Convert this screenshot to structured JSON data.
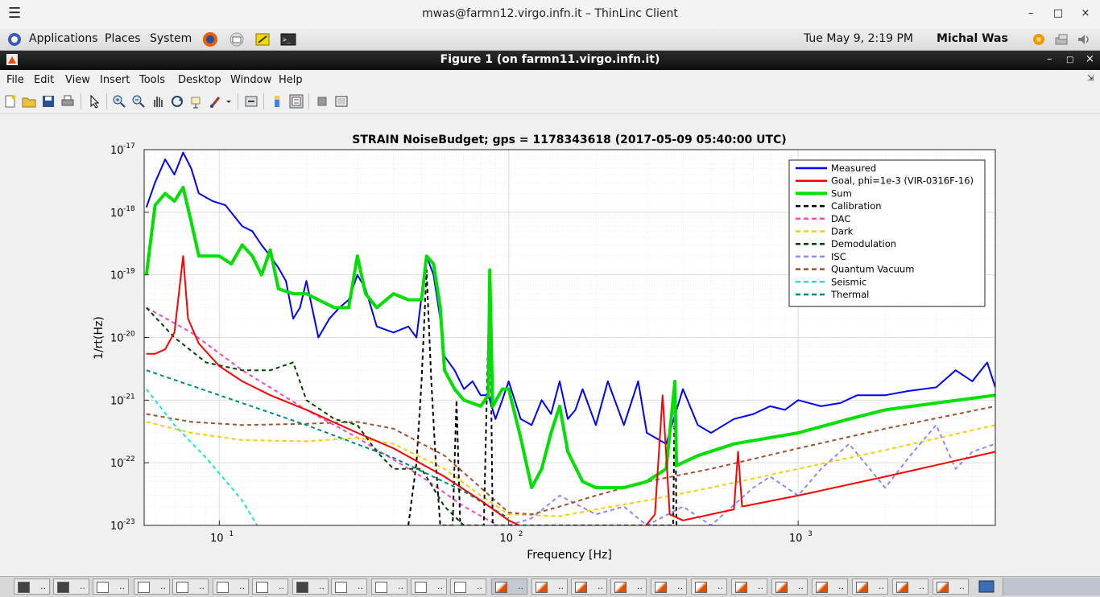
{
  "window": {
    "title": "mwas@farmn12.virgo.infn.it – ThinLinc Client",
    "buttons": [
      "–",
      "□",
      "×"
    ]
  },
  "panel": {
    "menus": [
      "Applications",
      "Places",
      "System"
    ],
    "clock": "Tue May  9,  2:19 PM",
    "user": "Michal Was"
  },
  "figure_window": {
    "title": "Figure 1 (on farmn11.virgo.infn.it)",
    "menus": [
      "File",
      "Edit",
      "View",
      "Insert",
      "Tools",
      "Desktop",
      "Window",
      "Help"
    ]
  },
  "toolbar_icons": [
    "new-file-icon",
    "open-folder-icon",
    "save-icon",
    "print-icon",
    "select-arrow-icon",
    "zoom-in-icon",
    "zoom-out-icon",
    "pan-hand-icon",
    "rotate-3d-icon",
    "data-cursor-icon",
    "brush-icon",
    "brush-dropdown-icon",
    "link-plot-icon",
    "colorbar-icon",
    "legend-icon",
    "hide-plot-tools-icon",
    "show-plot-tools-icon"
  ],
  "taskbar": {
    "buttons": [
      "..",
      "..",
      "..",
      "..",
      "..",
      "..",
      "..",
      "..",
      "..",
      "..",
      "..",
      "..",
      "..",
      "..",
      "..",
      "..",
      "..",
      "..",
      "..",
      "..",
      "..",
      "..",
      "..",
      ".."
    ]
  },
  "chart_data": {
    "type": "line",
    "title": "STRAIN NoiseBudget; gps = 1178343618 (2017-05-09 05:40:00 UTC)",
    "xlabel": "Frequency [Hz]",
    "ylabel": "1/rt(Hz)",
    "xscale": "log",
    "yscale": "log",
    "xlim": [
      5.5,
      4800
    ],
    "ylim": [
      1e-23,
      1e-17
    ],
    "xticks": [
      {
        "label": "10",
        "exp": "1",
        "value": 10
      },
      {
        "label": "10",
        "exp": "2",
        "value": 100
      },
      {
        "label": "10",
        "exp": "3",
        "value": 1000
      }
    ],
    "yticks": [
      {
        "label": "10",
        "exp": "-17",
        "value": 1e-17
      },
      {
        "label": "10",
        "exp": "-18",
        "value": 1e-18
      },
      {
        "label": "10",
        "exp": "-19",
        "value": 1e-19
      },
      {
        "label": "10",
        "exp": "-20",
        "value": 1e-20
      },
      {
        "label": "10",
        "exp": "-21",
        "value": 1e-21
      },
      {
        "label": "10",
        "exp": "-22",
        "value": 1e-22
      },
      {
        "label": "10",
        "exp": "-23",
        "value": 1e-23
      }
    ],
    "grid": true,
    "legend_position": "top-right",
    "series": [
      {
        "name": "Measured",
        "color": "#0000ff",
        "style": "solid",
        "width": 2,
        "points": [
          [
            5.6,
            1.2e-18
          ],
          [
            6,
            3e-18
          ],
          [
            6.5,
            7e-18
          ],
          [
            7,
            4e-18
          ],
          [
            7.5,
            9e-18
          ],
          [
            8,
            5e-18
          ],
          [
            8.5,
            2e-18
          ],
          [
            9.5,
            1.5e-18
          ],
          [
            10.5,
            1.3e-18
          ],
          [
            12,
            6e-19
          ],
          [
            13,
            5e-19
          ],
          [
            14,
            3e-19
          ],
          [
            15,
            2e-19
          ],
          [
            16,
            1.3e-19
          ],
          [
            17,
            8e-20
          ],
          [
            18,
            2e-20
          ],
          [
            19,
            3e-20
          ],
          [
            20,
            8e-20
          ],
          [
            22,
            1e-20
          ],
          [
            24,
            2e-20
          ],
          [
            26,
            3e-20
          ],
          [
            28,
            4e-20
          ],
          [
            30,
            1e-19
          ],
          [
            32,
            6e-20
          ],
          [
            35,
            1.5e-20
          ],
          [
            40,
            1.2e-20
          ],
          [
            45,
            1.5e-20
          ],
          [
            48,
            1e-20
          ],
          [
            52,
            2e-19
          ],
          [
            55,
            1e-19
          ],
          [
            58,
            2e-20
          ],
          [
            60,
            5e-21
          ],
          [
            65,
            3e-21
          ],
          [
            70,
            1.5e-21
          ],
          [
            75,
            2e-21
          ],
          [
            80,
            1.2e-21
          ],
          [
            85,
            1.2e-21
          ],
          [
            90,
            5e-22
          ],
          [
            95,
            1e-21
          ],
          [
            100,
            2e-21
          ],
          [
            110,
            5e-22
          ],
          [
            120,
            4e-22
          ],
          [
            130,
            1e-21
          ],
          [
            140,
            6e-22
          ],
          [
            150,
            2e-21
          ],
          [
            160,
            5e-22
          ],
          [
            170,
            7e-22
          ],
          [
            180,
            1.5e-21
          ],
          [
            200,
            4e-22
          ],
          [
            220,
            2e-21
          ],
          [
            250,
            4e-22
          ],
          [
            280,
            2e-21
          ],
          [
            300,
            3e-22
          ],
          [
            350,
            2e-22
          ],
          [
            400,
            1.5e-21
          ],
          [
            450,
            4e-22
          ],
          [
            500,
            3e-22
          ],
          [
            600,
            5e-22
          ],
          [
            700,
            6e-22
          ],
          [
            800,
            8e-22
          ],
          [
            900,
            7e-22
          ],
          [
            1000,
            1e-21
          ],
          [
            1200,
            8e-22
          ],
          [
            1400,
            9e-22
          ],
          [
            1600,
            1.2e-21
          ],
          [
            2000,
            1.2e-21
          ],
          [
            2400,
            1.4e-21
          ],
          [
            3000,
            1.6e-21
          ],
          [
            3500,
            3e-21
          ],
          [
            4000,
            2e-21
          ],
          [
            4500,
            4e-21
          ],
          [
            4800,
            1.6e-21
          ]
        ]
      },
      {
        "name": "Goal, phi=1e-3 (VIR-0316F-16)",
        "color": "#ff0000",
        "style": "solid",
        "width": 2,
        "points": [
          [
            5.6,
            5.5e-21
          ],
          [
            6,
            5.5e-21
          ],
          [
            6.5,
            6.5e-21
          ],
          [
            7,
            1.2e-20
          ],
          [
            7.5,
            2e-19
          ],
          [
            7.8,
            2e-20
          ],
          [
            8.5,
            8e-21
          ],
          [
            10,
            3.5e-21
          ],
          [
            12,
            2e-21
          ],
          [
            15,
            1.2e-21
          ],
          [
            20,
            7e-22
          ],
          [
            30,
            3e-22
          ],
          [
            40,
            1.7e-22
          ],
          [
            60,
            6e-23
          ],
          [
            80,
            2.5e-23
          ],
          [
            100,
            1.2e-23
          ],
          [
            150,
            5e-24
          ],
          [
            200,
            3e-24
          ],
          [
            280,
            7e-24
          ],
          [
            320,
            1.5e-23
          ],
          [
            340,
            1.2e-21
          ],
          [
            360,
            1.5e-23
          ],
          [
            400,
            1.2e-23
          ],
          [
            600,
            1.8e-23
          ],
          [
            620,
            1.5e-22
          ],
          [
            640,
            2e-23
          ],
          [
            1000,
            3e-23
          ],
          [
            2000,
            6e-23
          ],
          [
            4800,
            1.5e-22
          ]
        ]
      },
      {
        "name": "Sum",
        "color": "#00e000",
        "style": "solid",
        "width": 4,
        "points": [
          [
            5.6,
            1e-19
          ],
          [
            6,
            1.3e-18
          ],
          [
            6.5,
            2e-18
          ],
          [
            7,
            1.5e-18
          ],
          [
            7.5,
            2.5e-18
          ],
          [
            8,
            7e-19
          ],
          [
            8.5,
            2e-19
          ],
          [
            10,
            2e-19
          ],
          [
            11,
            1.5e-19
          ],
          [
            12,
            3e-19
          ],
          [
            13,
            2e-19
          ],
          [
            14,
            1e-19
          ],
          [
            15,
            2.5e-19
          ],
          [
            16,
            6e-20
          ],
          [
            18,
            5e-20
          ],
          [
            20,
            5e-20
          ],
          [
            22,
            4e-20
          ],
          [
            25,
            3e-20
          ],
          [
            28,
            3e-20
          ],
          [
            30,
            2e-19
          ],
          [
            32,
            5e-20
          ],
          [
            35,
            3e-20
          ],
          [
            40,
            5e-20
          ],
          [
            45,
            4e-20
          ],
          [
            50,
            4e-20
          ],
          [
            52,
            2e-19
          ],
          [
            55,
            1.5e-19
          ],
          [
            58,
            3e-20
          ],
          [
            60,
            3e-21
          ],
          [
            65,
            1.5e-21
          ],
          [
            70,
            1e-21
          ],
          [
            80,
            8e-22
          ],
          [
            85,
            1.2e-21
          ],
          [
            86,
            1.2e-19
          ],
          [
            88,
            8e-22
          ],
          [
            95,
            1.5e-21
          ],
          [
            100,
            1.5e-21
          ],
          [
            110,
            2.5e-22
          ],
          [
            120,
            4e-23
          ],
          [
            130,
            8e-23
          ],
          [
            140,
            3e-22
          ],
          [
            150,
            8e-22
          ],
          [
            160,
            1.5e-22
          ],
          [
            180,
            5e-23
          ],
          [
            200,
            4e-23
          ],
          [
            250,
            4e-23
          ],
          [
            300,
            5e-23
          ],
          [
            350,
            8e-23
          ],
          [
            375,
            2e-21
          ],
          [
            380,
            9e-23
          ],
          [
            450,
            1.3e-22
          ],
          [
            600,
            2e-22
          ],
          [
            1000,
            3e-22
          ],
          [
            1500,
            5e-22
          ],
          [
            2000,
            7e-22
          ],
          [
            3000,
            9e-22
          ],
          [
            4800,
            1.2e-21
          ]
        ]
      },
      {
        "name": "Calibration",
        "color": "#000000",
        "style": "dashed",
        "width": 2,
        "points": [
          [
            45,
            1e-23
          ],
          [
            48,
            1e-22
          ],
          [
            50,
            2e-21
          ],
          [
            52,
            1.2e-19
          ],
          [
            54,
            2e-21
          ],
          [
            56,
            1e-22
          ],
          [
            58,
            1e-23
          ],
          [
            64,
            1e-23
          ],
          [
            66,
            1e-21
          ],
          [
            68,
            1e-23
          ],
          [
            82,
            1e-23
          ],
          [
            86,
            1.2e-19
          ],
          [
            88,
            1e-23
          ],
          [
            370,
            1e-23
          ],
          [
            375,
            2e-21
          ],
          [
            380,
            1e-23
          ]
        ]
      },
      {
        "name": "DAC",
        "color": "#ff44cc",
        "style": "dashed",
        "width": 2,
        "points": [
          [
            5.6,
            3e-20
          ],
          [
            8,
            1.2e-20
          ],
          [
            12,
            3e-21
          ],
          [
            20,
            7e-22
          ],
          [
            30,
            2.5e-22
          ],
          [
            50,
            6e-23
          ],
          [
            70,
            2e-23
          ],
          [
            100,
            8e-24
          ]
        ]
      },
      {
        "name": "Dark",
        "color": "#ffcc00",
        "style": "dashed",
        "width": 2,
        "points": [
          [
            5.6,
            4.5e-22
          ],
          [
            8,
            3e-22
          ],
          [
            12,
            2.3e-22
          ],
          [
            20,
            2.2e-22
          ],
          [
            30,
            2.5e-22
          ],
          [
            40,
            2e-22
          ],
          [
            60,
            8e-23
          ],
          [
            80,
            3e-23
          ],
          [
            100,
            1.5e-23
          ],
          [
            150,
            1.4e-23
          ],
          [
            200,
            1.8e-23
          ],
          [
            300,
            2.5e-23
          ],
          [
            500,
            4e-23
          ],
          [
            1000,
            8e-23
          ],
          [
            2000,
            1.6e-22
          ],
          [
            4800,
            4e-22
          ]
        ]
      },
      {
        "name": "Demodulation",
        "color": "#004400",
        "style": "dashed",
        "width": 2,
        "points": [
          [
            5.6,
            3e-20
          ],
          [
            7,
            1e-20
          ],
          [
            9,
            4e-21
          ],
          [
            12,
            3e-21
          ],
          [
            15,
            3e-21
          ],
          [
            18,
            4e-21
          ],
          [
            20,
            1e-21
          ],
          [
            25,
            5e-22
          ],
          [
            30,
            4e-22
          ],
          [
            35,
            1.5e-22
          ],
          [
            40,
            8e-23
          ],
          [
            50,
            8e-23
          ],
          [
            60,
            2e-23
          ],
          [
            70,
            1e-23
          ]
        ]
      },
      {
        "name": "ISC",
        "color": "#8888ff",
        "style": "dashed",
        "width": 2,
        "points": [
          [
            100,
            1e-23
          ],
          [
            120,
            1.3e-23
          ],
          [
            150,
            3e-23
          ],
          [
            200,
            1.5e-23
          ],
          [
            250,
            2e-23
          ],
          [
            300,
            1e-23
          ],
          [
            400,
            2e-23
          ],
          [
            500,
            1e-23
          ],
          [
            700,
            4e-23
          ],
          [
            800,
            6e-23
          ],
          [
            1000,
            3e-23
          ],
          [
            1200,
            8e-23
          ],
          [
            1500,
            2e-22
          ],
          [
            2000,
            4e-23
          ],
          [
            2500,
            1.5e-22
          ],
          [
            3000,
            4e-22
          ],
          [
            3500,
            8e-23
          ],
          [
            4000,
            1.5e-22
          ],
          [
            4800,
            2e-22
          ]
        ]
      },
      {
        "name": "Quantum Vacuum",
        "color": "#a0522d",
        "style": "dashed",
        "width": 2,
        "points": [
          [
            5.6,
            6e-22
          ],
          [
            8,
            4.5e-22
          ],
          [
            12,
            4e-22
          ],
          [
            20,
            4.2e-22
          ],
          [
            30,
            4.5e-22
          ],
          [
            40,
            3.5e-22
          ],
          [
            60,
            1.3e-22
          ],
          [
            80,
            4e-23
          ],
          [
            100,
            1.6e-23
          ],
          [
            120,
            1.5e-23
          ],
          [
            150,
            2e-23
          ],
          [
            200,
            3e-23
          ],
          [
            300,
            5e-23
          ],
          [
            500,
            8e-23
          ],
          [
            1000,
            1.7e-22
          ],
          [
            2000,
            3.5e-22
          ],
          [
            4800,
            8e-22
          ]
        ]
      },
      {
        "name": "Seismic",
        "color": "#22e0e0",
        "style": "dashed",
        "width": 2,
        "points": [
          [
            5.6,
            1.5e-21
          ],
          [
            7,
            4e-22
          ],
          [
            9,
            1.2e-22
          ],
          [
            12,
            2.5e-23
          ],
          [
            13.5,
            1e-23
          ]
        ]
      },
      {
        "name": "Thermal",
        "color": "#008888",
        "style": "dashed",
        "width": 2,
        "points": [
          [
            5.6,
            3e-21
          ],
          [
            10,
            1.2e-21
          ],
          [
            20,
            4e-22
          ],
          [
            40,
            1.2e-22
          ],
          [
            70,
            3.5e-23
          ],
          [
            100,
            1.3e-23
          ]
        ]
      }
    ]
  }
}
